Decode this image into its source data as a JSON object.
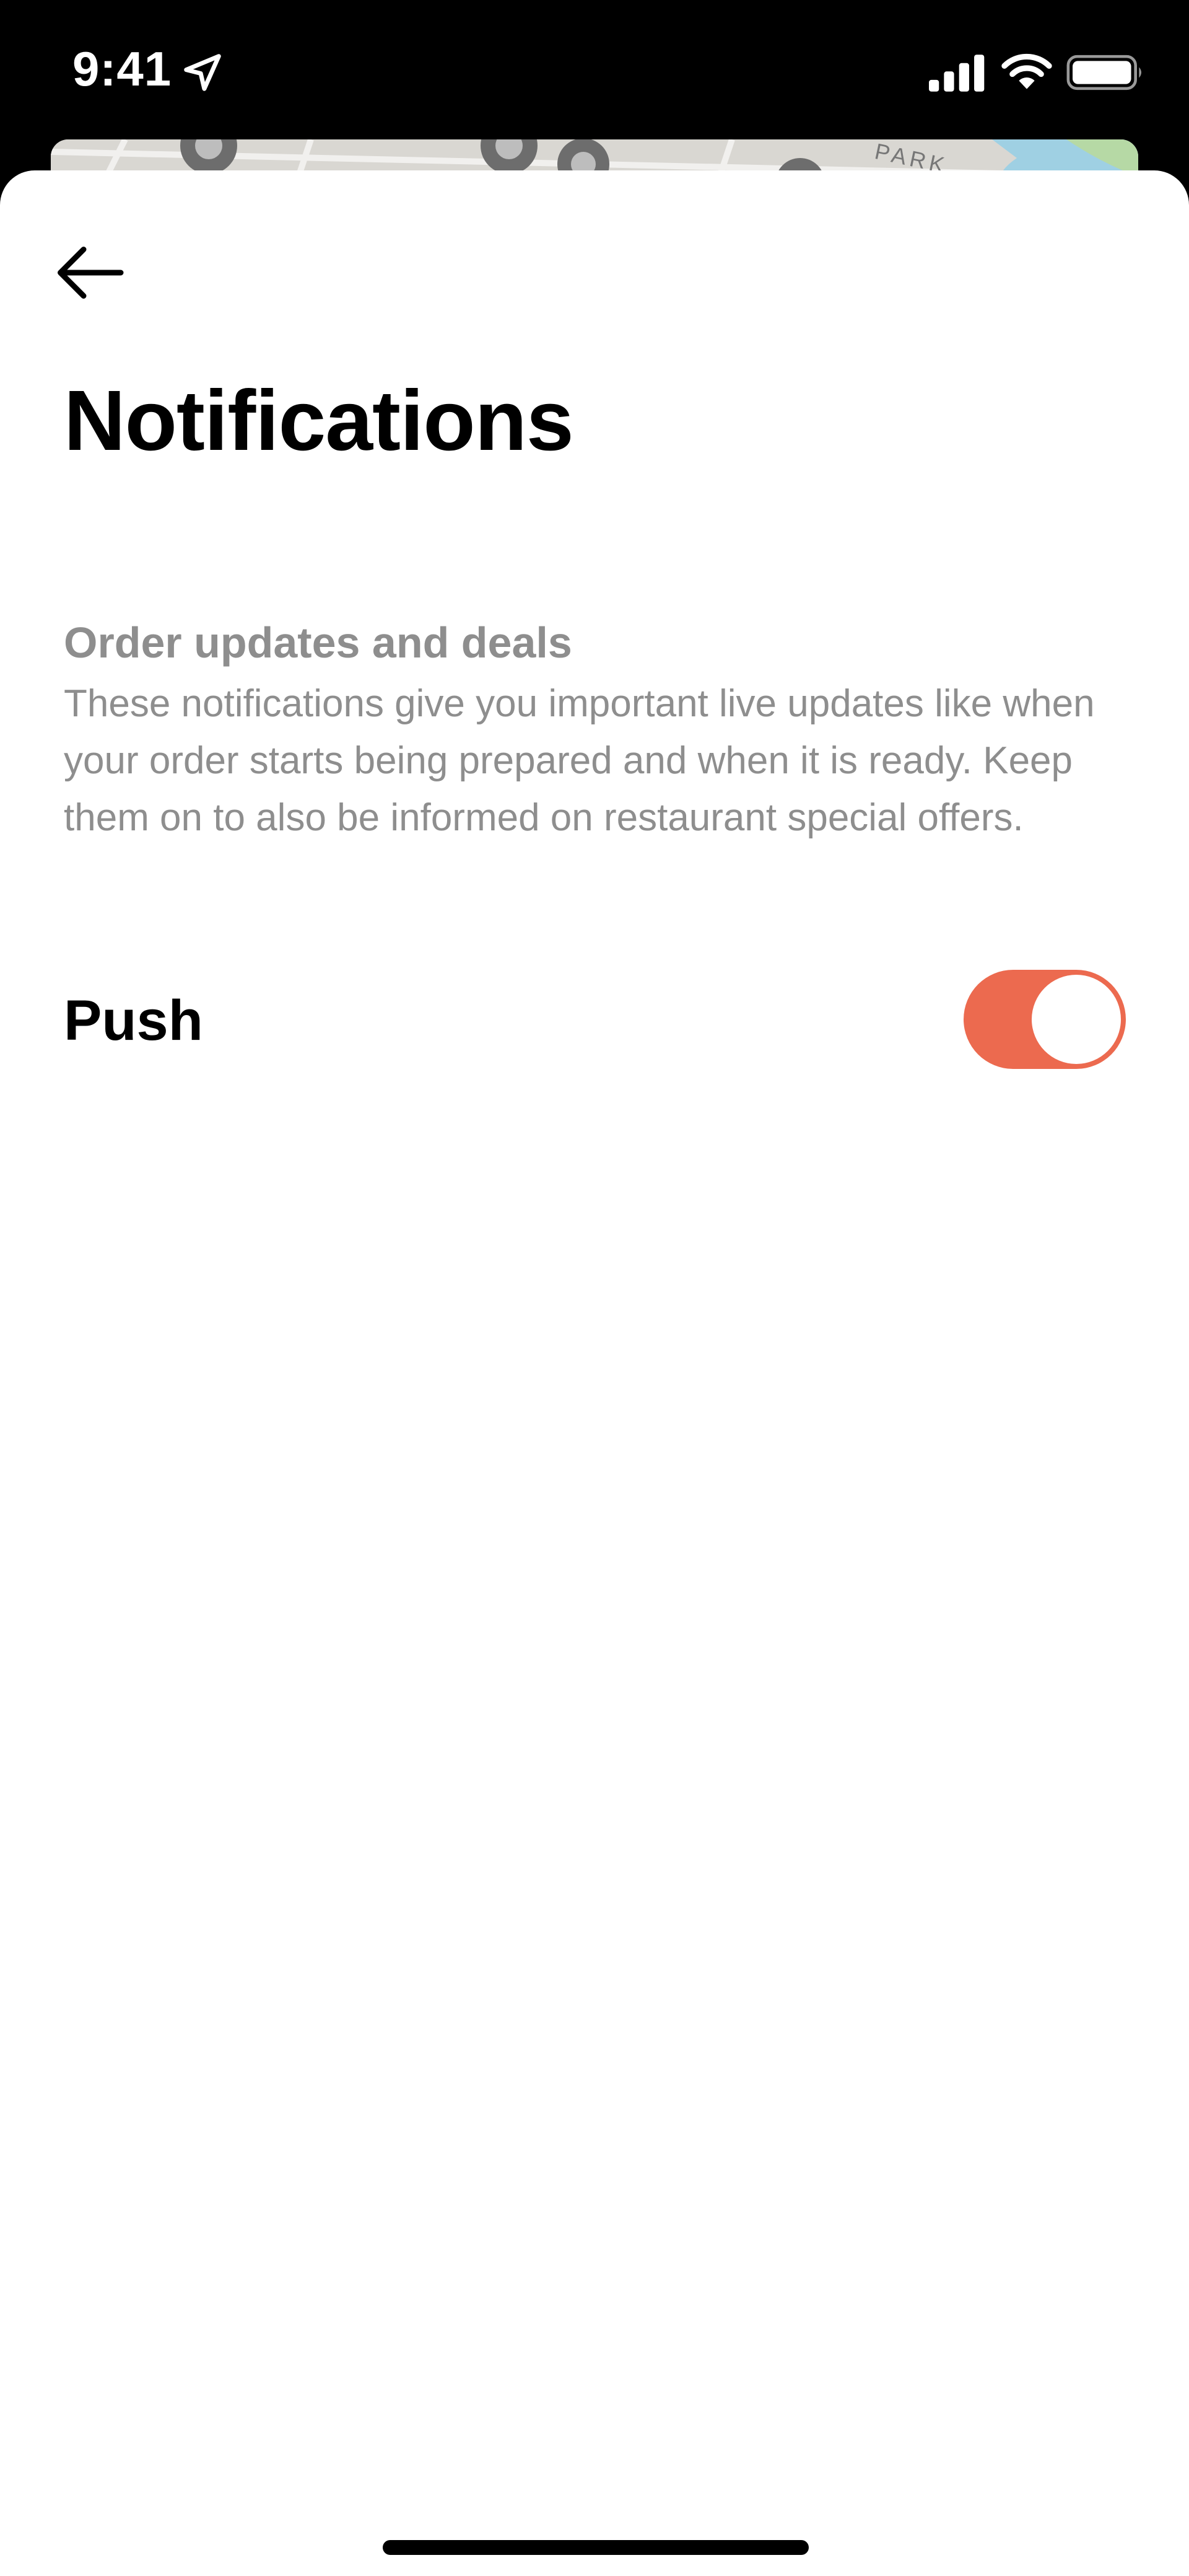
{
  "status_bar": {
    "time": "9:41",
    "icons": [
      "location-arrow-icon",
      "cellular-signal-icon",
      "wifi-icon",
      "battery-icon"
    ]
  },
  "map": {
    "label": "PARK"
  },
  "header": {
    "back_icon": "arrow-left-icon",
    "title": "Notifications"
  },
  "section": {
    "title": "Order updates and deals",
    "description": "These notifications give you important live updates like when your order starts being prepared and when it is ready. Keep them on to also be informed on restaurant special offers."
  },
  "push": {
    "label": "Push",
    "enabled": true
  },
  "colors": {
    "accent": "#ec6a4f",
    "muted_text": "#8e8e8e",
    "primary_text": "#000000",
    "background": "#ffffff"
  }
}
